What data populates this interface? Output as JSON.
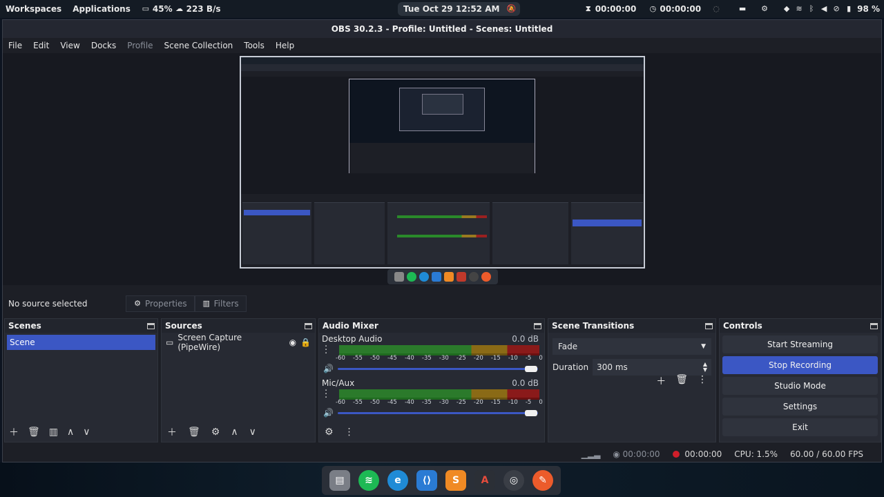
{
  "topbar": {
    "workspaces": "Workspaces",
    "applications": "Applications",
    "battery_cpu": "45%",
    "network": "223 B/s",
    "clock": "Tue Oct 29  12:52 AM",
    "timer1": "00:00:00",
    "timer2": "00:00:00",
    "battery": "98 %"
  },
  "window": {
    "title": "OBS 30.2.3 - Profile: Untitled - Scenes: Untitled"
  },
  "menu": {
    "file": "File",
    "edit": "Edit",
    "view": "View",
    "docks": "Docks",
    "profile": "Profile",
    "scene_collection": "Scene Collection",
    "tools": "Tools",
    "help": "Help"
  },
  "source_toolbar": {
    "no_source": "No source selected",
    "properties": "Properties",
    "filters": "Filters"
  },
  "scenes": {
    "title": "Scenes",
    "items": [
      "Scene"
    ]
  },
  "sources": {
    "title": "Sources",
    "items": [
      "Screen Capture (PipeWire)"
    ]
  },
  "mixer": {
    "title": "Audio Mixer",
    "channels": [
      {
        "name": "Desktop Audio",
        "db": "0.0 dB",
        "volume": 1.0
      },
      {
        "name": "Mic/Aux",
        "db": "0.0 dB",
        "volume": 1.0
      }
    ],
    "ticks": [
      "-60",
      "-55",
      "-50",
      "-45",
      "-40",
      "-35",
      "-30",
      "-25",
      "-20",
      "-15",
      "-10",
      "-5",
      "0"
    ]
  },
  "transitions": {
    "title": "Scene Transitions",
    "selected": "Fade",
    "duration_label": "Duration",
    "duration_value": "300 ms"
  },
  "controls": {
    "title": "Controls",
    "start_streaming": "Start Streaming",
    "stop_recording": "Stop Recording",
    "studio_mode": "Studio Mode",
    "settings": "Settings",
    "exit": "Exit"
  },
  "status": {
    "stream_time": "00:00:00",
    "rec_time": "00:00:00",
    "cpu": "CPU: 1.5%",
    "fps": "60.00 / 60.00 FPS"
  },
  "colors": {
    "accent": "#3b57c4",
    "record": "#d01e2a"
  }
}
